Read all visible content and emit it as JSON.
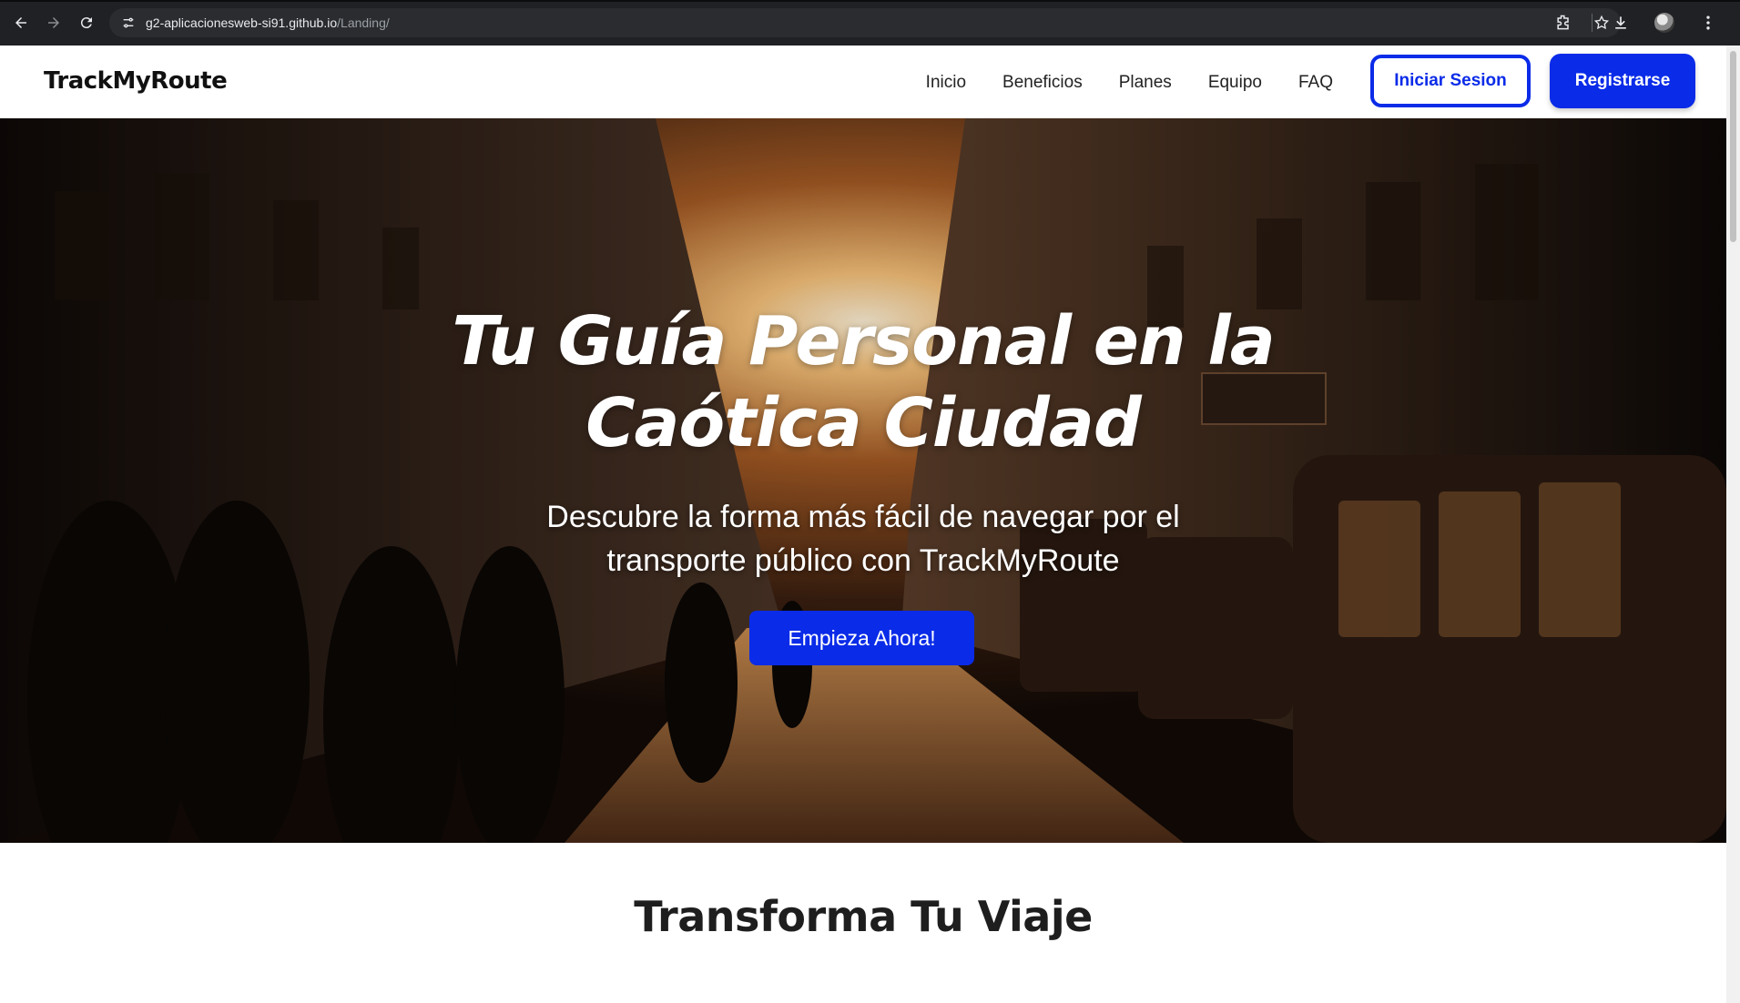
{
  "browser": {
    "url_host": "g2-aplicacionesweb-si91.github.io",
    "url_path": "/Landing/",
    "icons": [
      "back-icon",
      "forward-icon",
      "reload-icon",
      "site-info-icon",
      "bookmark-star-icon",
      "extensions-icon",
      "download-icon",
      "profile-avatar"
    ]
  },
  "header": {
    "logo": "TrackMyRoute",
    "nav": [
      "Inicio",
      "Beneficios",
      "Planes",
      "Equipo",
      "FAQ"
    ],
    "login_label": "Iniciar Sesion",
    "register_label": "Registrarse"
  },
  "hero": {
    "title_line1": "Tu Guía Personal en la",
    "title_line2": "Caótica Ciudad",
    "subtitle_line1": "Descubre la forma más fácil de navegar por el",
    "subtitle_line2": "transporte público con TrackMyRoute",
    "cta_label": "Empieza Ahora!"
  },
  "section": {
    "title": "Transforma Tu Viaje"
  },
  "colors": {
    "brand_blue": "#0a2be8",
    "chrome_dark": "#202124",
    "omnibox": "#2b2c2f"
  }
}
